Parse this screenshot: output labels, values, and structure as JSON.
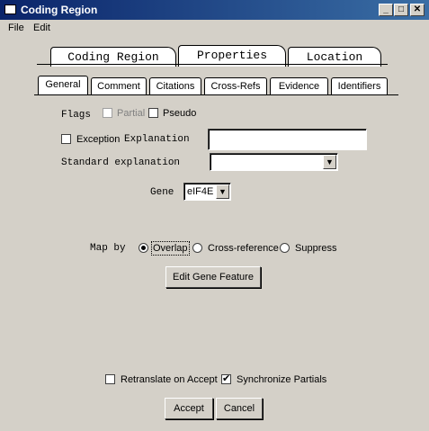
{
  "window": {
    "title": "Coding Region",
    "minimize_glyph": "_",
    "maximize_glyph": "□",
    "close_glyph": "✕"
  },
  "menubar": {
    "items": [
      "File",
      "Edit"
    ]
  },
  "main_tabs": [
    {
      "label": "Coding Region",
      "selected": false
    },
    {
      "label": "Properties",
      "selected": true
    },
    {
      "label": "Location",
      "selected": false
    }
  ],
  "sub_tabs": [
    {
      "label": "General",
      "selected": true
    },
    {
      "label": "Comment",
      "selected": false
    },
    {
      "label": "Citations",
      "selected": false
    },
    {
      "label": "Cross-Refs",
      "selected": false
    },
    {
      "label": "Evidence",
      "selected": false
    },
    {
      "label": "Identifiers",
      "selected": false
    }
  ],
  "form": {
    "flags_label": "Flags",
    "partial_label": "Partial",
    "partial_checked": false,
    "pseudo_label": "Pseudo",
    "pseudo_checked": false,
    "exception_label": "Exception",
    "exception_checked": false,
    "explanation_label": "Explanation",
    "explanation_value": "",
    "standard_explanation_label": "Standard explanation",
    "standard_explanation_value": "",
    "gene_label": "Gene",
    "gene_value": "eIF4E",
    "map_by_label": "Map by",
    "map_options": [
      {
        "label": "Overlap",
        "checked": true
      },
      {
        "label": "Cross-reference",
        "checked": false
      },
      {
        "label": "Suppress",
        "checked": false
      }
    ],
    "edit_gene_button": "Edit Gene Feature"
  },
  "footer": {
    "retranslate_label": "Retranslate on Accept",
    "retranslate_checked": false,
    "sync_partials_label": "Synchronize Partials",
    "sync_partials_checked": true,
    "accept_button": "Accept",
    "cancel_button": "Cancel"
  }
}
